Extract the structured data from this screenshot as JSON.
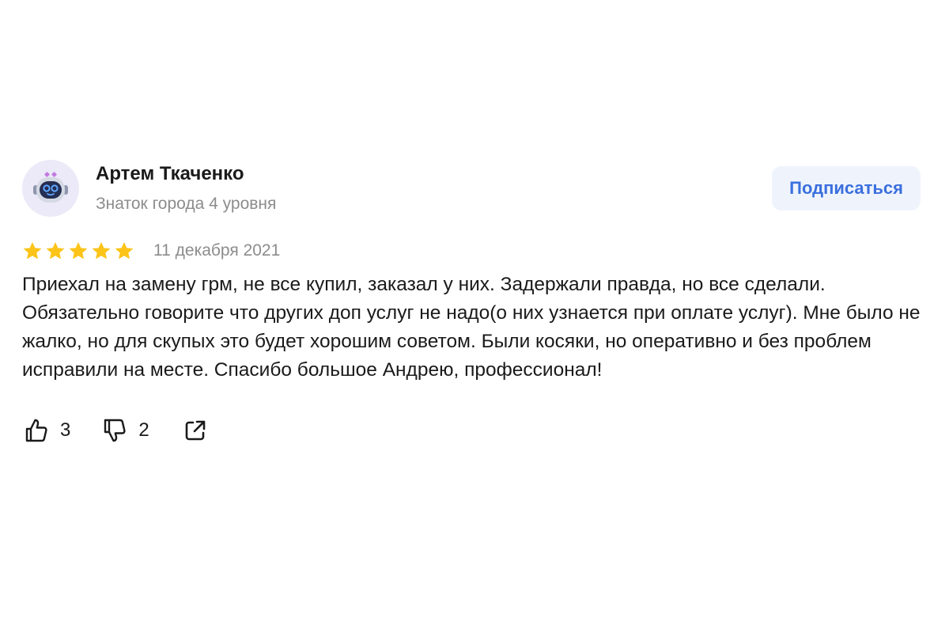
{
  "review": {
    "author": {
      "name": "Артем Ткаченко",
      "level": "Знаток города 4 уровня",
      "avatar_icon": "robot-avatar-icon"
    },
    "subscribe_label": "Подписаться",
    "rating": 5,
    "rating_max": 5,
    "date": "11 декабря 2021",
    "text": "Приехал на замену грм, не все купил, заказал у них. Задержали правда, но все сделали. Обязательно говорите что других доп услуг не надо(о них узнается при оплате услуг). Мне было не жалко, но для скупых это будет хорошим советом. Были косяки, но оперативно и без проблем исправили на месте. Спасибо большое Андрею, профессионал!",
    "likes": "3",
    "dislikes": "2",
    "icons": {
      "like": "thumbs-up-icon",
      "dislike": "thumbs-down-icon",
      "share": "share-icon",
      "star": "star-icon"
    }
  },
  "colors": {
    "star": "#fcc419",
    "accent": "#3a6fde",
    "button_bg": "#eff4fc",
    "muted_text": "#8c8c8c",
    "avatar_bg": "#ece9f8"
  }
}
